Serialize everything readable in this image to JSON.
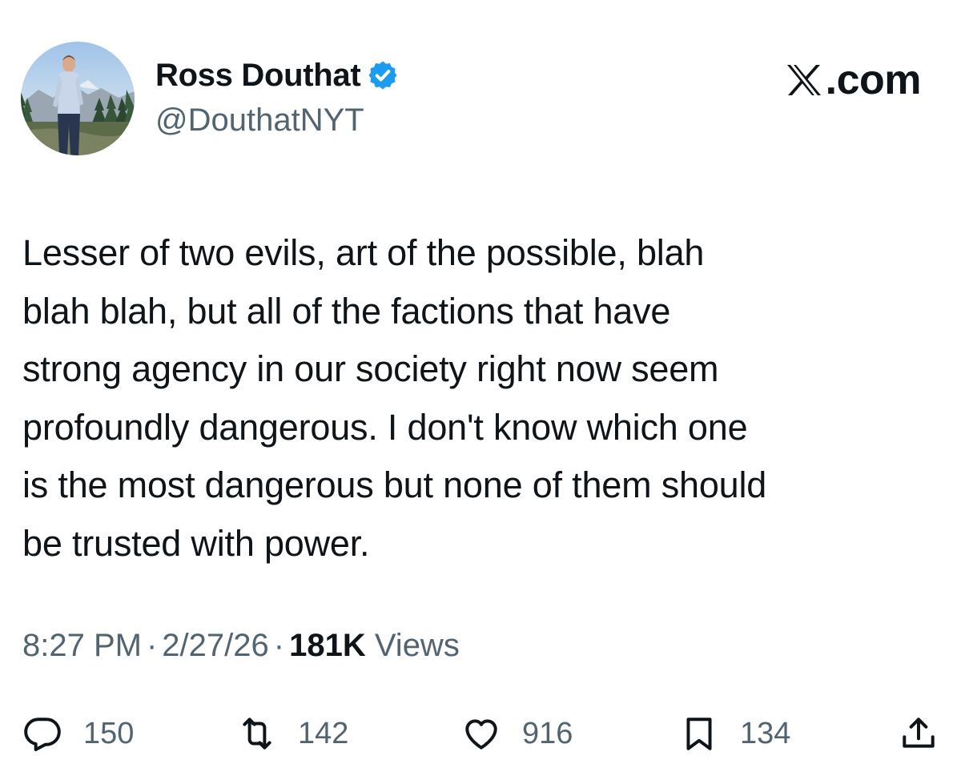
{
  "author": {
    "display_name": "Ross Douthat",
    "handle": "@DouthatNYT",
    "verified": true,
    "verified_color": "#1d9bf0"
  },
  "brand": {
    "label": ".com",
    "icon": "x-logo-icon"
  },
  "tweet": {
    "text": "Lesser of two evils, art of the possible, blah\nblah blah, but all of the factions that have\nstrong agency in our society right now seem\nprofoundly dangerous. I don't know which one\nis the most dangerous but none of them should\nbe trusted with power."
  },
  "meta": {
    "time": "8:27 PM",
    "separator": "·",
    "date": "2/27/26",
    "views_count": "181K",
    "views_label": "Views"
  },
  "actions": {
    "reply": {
      "icon": "reply-icon",
      "count": "150"
    },
    "repost": {
      "icon": "repost-icon",
      "count": "142"
    },
    "like": {
      "icon": "heart-icon",
      "count": "916"
    },
    "bookmark": {
      "icon": "bookmark-icon",
      "count": "134"
    },
    "share": {
      "icon": "share-icon"
    }
  },
  "colors": {
    "text_primary": "#0f1419",
    "text_secondary": "#536471"
  }
}
